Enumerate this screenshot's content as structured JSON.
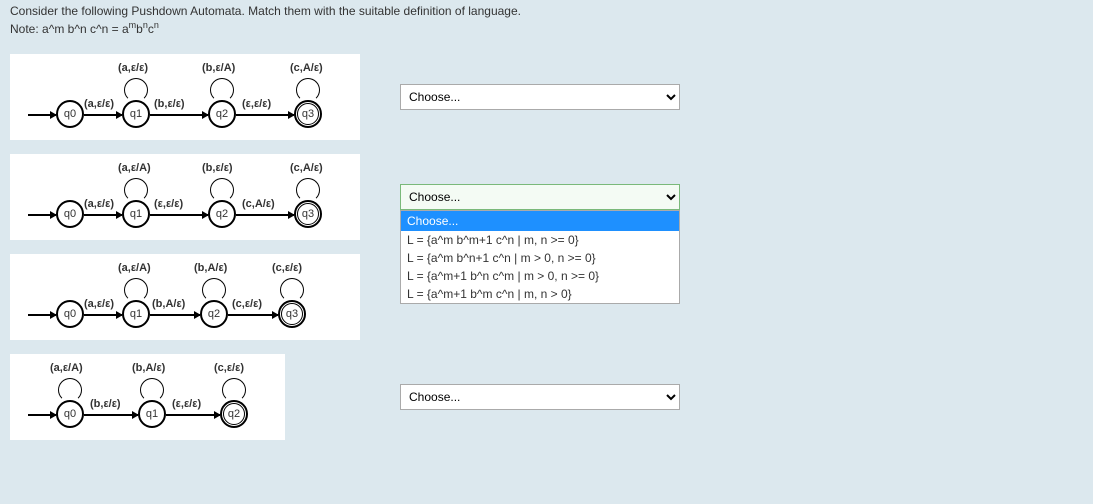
{
  "question": {
    "text": "Consider the following Pushdown Automata. Match them with the suitable definition of language.",
    "note_prefix": "Note: a^m b^n c^n = a",
    "note_sup1": "m",
    "note_mid1": "b",
    "note_sup2": "n",
    "note_mid2": "c",
    "note_sup3": "n"
  },
  "states": {
    "q0": "q0",
    "q1": "q1",
    "q2": "q2",
    "q3": "q3"
  },
  "pda1": {
    "loop_q1": "(a,ε/ε)",
    "loop_q2": "(b,ε/A)",
    "loop_q3": "(c,A/ε)",
    "e01": "(a,ε/ε)",
    "e12": "(b,ε/ε)",
    "e23": "(ε,ε/ε)"
  },
  "pda2": {
    "loop_q1": "(a,ε/A)",
    "loop_q2": "(b,ε/ε)",
    "loop_q3": "(c,A/ε)",
    "e01": "(a,ε/ε)",
    "e12": "(ε,ε/ε)",
    "e23": "(c,A/ε)"
  },
  "pda3": {
    "loop_q1": "(a,ε/A)",
    "loop_q2": "(b,A/ε)",
    "loop_q3": "(c,ε/ε)",
    "e01": "(a,ε/ε)",
    "e12": "(b,A/ε)",
    "e23": "(c,ε/ε)"
  },
  "pda4": {
    "loop_q0": "(a,ε/A)",
    "loop_q1": "(b,A/ε)",
    "loop_q2": "(c,ε/ε)",
    "e01": "(b,ε/ε)",
    "e12": "(ε,ε/ε)"
  },
  "dropdown": {
    "placeholder": "Choose...",
    "options": [
      "L = {a^m b^m+1 c^n | m, n >= 0}",
      "L = {a^m b^n+1 c^n | m > 0, n >= 0}",
      "L = {a^m+1 b^n c^m | m > 0, n >= 0}",
      "L = {a^m+1 b^m c^n | m, n > 0}"
    ]
  }
}
